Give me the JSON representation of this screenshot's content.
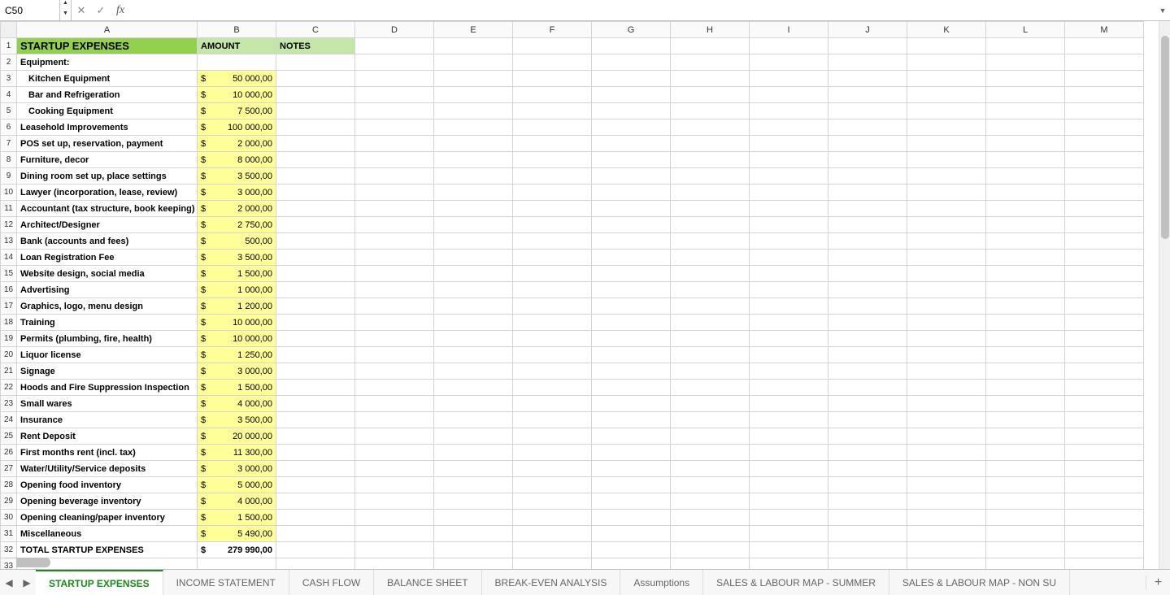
{
  "namebox": "C50",
  "fx_label": "fx",
  "columns": [
    "A",
    "B",
    "C",
    "D",
    "E",
    "F",
    "G",
    "H",
    "I",
    "J",
    "K",
    "L",
    "M"
  ],
  "header": {
    "title": "STARTUP EXPENSES",
    "amount": "AMOUNT",
    "notes": "NOTES"
  },
  "rows": [
    {
      "n": 2,
      "label": "Equipment:",
      "indent": false,
      "amount": null
    },
    {
      "n": 3,
      "label": "Kitchen Equipment",
      "indent": true,
      "amount": "50 000,00"
    },
    {
      "n": 4,
      "label": "Bar and Refrigeration",
      "indent": true,
      "amount": "10 000,00"
    },
    {
      "n": 5,
      "label": "Cooking Equipment",
      "indent": true,
      "amount": "7 500,00"
    },
    {
      "n": 6,
      "label": "Leasehold Improvements",
      "indent": false,
      "amount": "100 000,00"
    },
    {
      "n": 7,
      "label": "POS set up, reservation, payment",
      "indent": false,
      "amount": "2 000,00"
    },
    {
      "n": 8,
      "label": "Furniture, decor",
      "indent": false,
      "amount": "8 000,00"
    },
    {
      "n": 9,
      "label": "Dining room set up, place settings",
      "indent": false,
      "amount": "3 500,00"
    },
    {
      "n": 10,
      "label": "Lawyer (incorporation, lease, review)",
      "indent": false,
      "amount": "3 000,00"
    },
    {
      "n": 11,
      "label": "Accountant (tax structure, book keeping)",
      "indent": false,
      "amount": "2 000,00"
    },
    {
      "n": 12,
      "label": "Architect/Designer",
      "indent": false,
      "amount": "2 750,00"
    },
    {
      "n": 13,
      "label": "Bank (accounts and fees)",
      "indent": false,
      "amount": "500,00"
    },
    {
      "n": 14,
      "label": "Loan Registration Fee",
      "indent": false,
      "amount": "3 500,00"
    },
    {
      "n": 15,
      "label": "Website design, social media",
      "indent": false,
      "amount": "1 500,00"
    },
    {
      "n": 16,
      "label": "Advertising",
      "indent": false,
      "amount": "1 000,00"
    },
    {
      "n": 17,
      "label": "Graphics, logo, menu design",
      "indent": false,
      "amount": "1 200,00"
    },
    {
      "n": 18,
      "label": "Training",
      "indent": false,
      "amount": "10 000,00"
    },
    {
      "n": 19,
      "label": "Permits (plumbing, fire, health)",
      "indent": false,
      "amount": "10 000,00"
    },
    {
      "n": 20,
      "label": "Liquor license",
      "indent": false,
      "amount": "1 250,00"
    },
    {
      "n": 21,
      "label": "Signage",
      "indent": false,
      "amount": "3 000,00"
    },
    {
      "n": 22,
      "label": "Hoods and Fire Suppression Inspection",
      "indent": false,
      "amount": "1 500,00"
    },
    {
      "n": 23,
      "label": "Small wares",
      "indent": false,
      "amount": "4 000,00"
    },
    {
      "n": 24,
      "label": "Insurance",
      "indent": false,
      "amount": "3 500,00"
    },
    {
      "n": 25,
      "label": "Rent Deposit",
      "indent": false,
      "amount": "20 000,00"
    },
    {
      "n": 26,
      "label": "First months rent (incl. tax)",
      "indent": false,
      "amount": "11 300,00"
    },
    {
      "n": 27,
      "label": "Water/Utility/Service deposits",
      "indent": false,
      "amount": "3 000,00"
    },
    {
      "n": 28,
      "label": "Opening food inventory",
      "indent": false,
      "amount": "5 000,00"
    },
    {
      "n": 29,
      "label": "Opening beverage inventory",
      "indent": false,
      "amount": "4 000,00"
    },
    {
      "n": 30,
      "label": "Opening cleaning/paper inventory",
      "indent": false,
      "amount": "1 500,00"
    },
    {
      "n": 31,
      "label": "Miscellaneous",
      "indent": false,
      "amount": "5 490,00"
    }
  ],
  "total": {
    "n": 32,
    "label": "TOTAL STARTUP EXPENSES",
    "amount": "279 990,00"
  },
  "extra_row": 33,
  "tabs": [
    "STARTUP EXPENSES",
    "INCOME STATEMENT",
    "CASH FLOW",
    "BALANCE SHEET",
    "BREAK-EVEN ANALYSIS",
    "Assumptions",
    "SALES & LABOUR MAP - SUMMER",
    "SALES & LABOUR MAP - NON SU"
  ],
  "active_tab": 0
}
